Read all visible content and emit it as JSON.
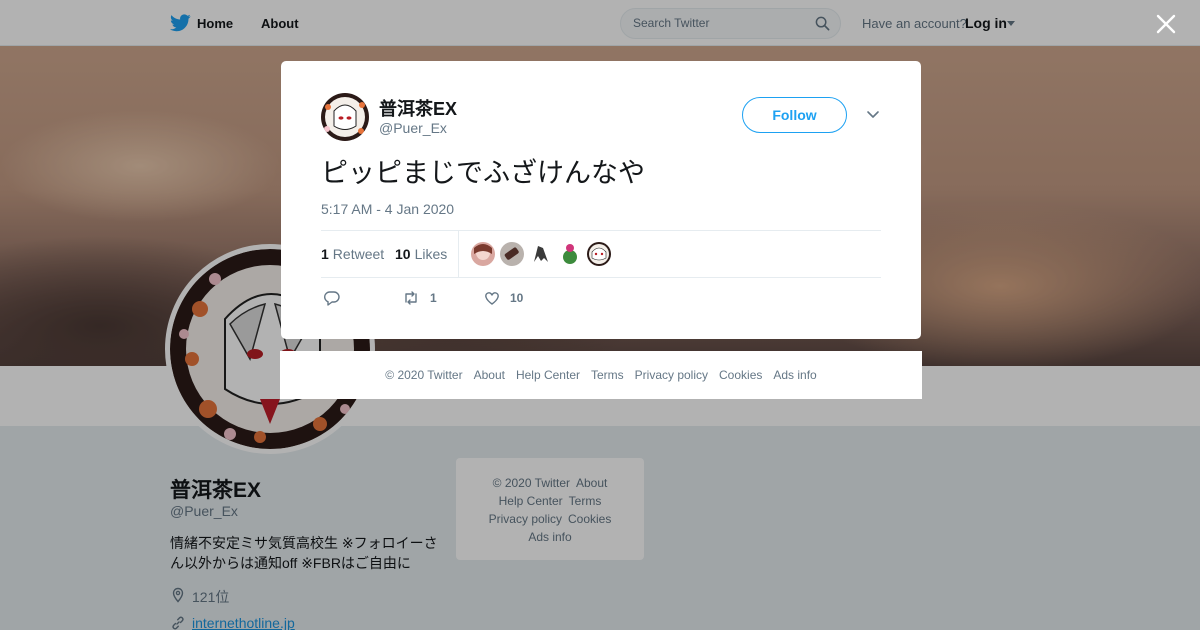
{
  "topbar": {
    "home_label": "Home",
    "about_label": "About",
    "search_placeholder": "Search Twitter",
    "account_question": "Have an account?",
    "login_label": "Log in",
    "brand_color": "#1da1f2"
  },
  "profile": {
    "name": "普洱茶EX",
    "handle": "@Puer_Ex",
    "bio": "情緒不安定ミサ気質高校生 ※フォロイーさん以外からは通知off ※FBRはご自由に",
    "location": "121位",
    "link": "internethotline.jp"
  },
  "side_footer": {
    "line1": [
      "© 2020 Twitter",
      "About"
    ],
    "line2": [
      "Help Center",
      "Terms"
    ],
    "line3": [
      "Privacy policy",
      "Cookies"
    ],
    "line4": [
      "Ads info"
    ]
  },
  "tweet": {
    "author_name": "普洱茶EX",
    "author_handle": "@Puer_Ex",
    "follow_label": "Follow",
    "text": "ピッピまじでふざけんなや",
    "timestamp": "5:17 AM - 4 Jan 2020",
    "retweet_count": "1",
    "retweet_label": "Retweet",
    "like_count": "10",
    "like_label": "Likes",
    "action_retweet_count": "1",
    "action_like_count": "10"
  },
  "modal_footer": {
    "items": [
      "© 2020 Twitter",
      "About",
      "Help Center",
      "Terms",
      "Privacy policy",
      "Cookies",
      "Ads info"
    ]
  },
  "icons": [
    "twitter-bird-icon",
    "search-icon",
    "caret-down-icon",
    "close-icon",
    "chevron-down-icon",
    "reply-icon",
    "retweet-icon",
    "heart-icon",
    "location-icon",
    "link-icon"
  ]
}
